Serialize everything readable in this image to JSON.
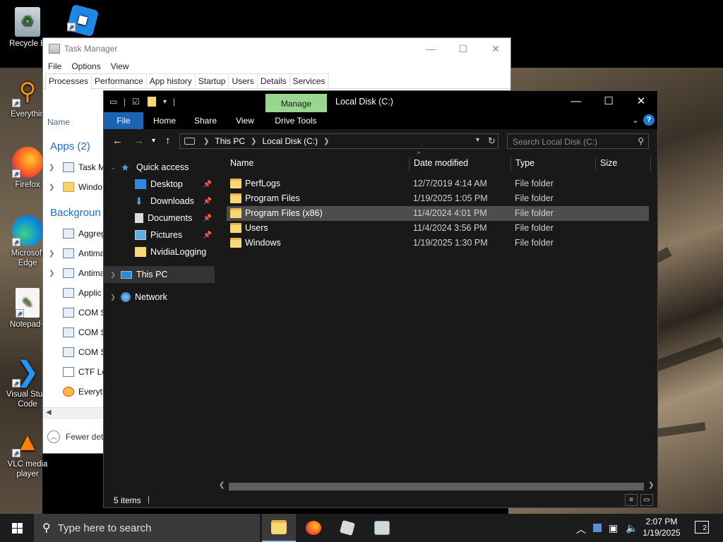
{
  "desktop": {
    "icons": [
      {
        "label": "Recycle Bin",
        "icon": "recycle-bin-icon"
      },
      {
        "label": "Roblox",
        "icon": "roblox-icon"
      },
      {
        "label": "Everything",
        "icon": "everything-search-icon"
      },
      {
        "label": "Firefox",
        "icon": "firefox-icon"
      },
      {
        "label": "Microsoft Edge",
        "icon": "edge-icon"
      },
      {
        "label": "Notepad++",
        "icon": "notepad-plus-plus-icon"
      },
      {
        "label": "Visual Studio Code",
        "icon": "vscode-icon"
      },
      {
        "label": "VLC media player",
        "icon": "vlc-icon"
      }
    ],
    "labels_visible": {
      "recycle": "Recycle B",
      "everything": "Everythin",
      "firefox": "Firefox",
      "edge_1": "Microsoft",
      "edge_2": "Edge",
      "notepad": "Notepad+",
      "vscode_1": "Visual Studi",
      "vscode_2": "Code",
      "vlc_1": "VLC media",
      "vlc_2": "player"
    }
  },
  "task_manager": {
    "title": "Task Manager",
    "menu": [
      "File",
      "Options",
      "View"
    ],
    "tabs": [
      "Processes",
      "Performance",
      "App history",
      "Startup",
      "Users",
      "Details",
      "Services"
    ],
    "active_tab": "Processes",
    "column_name": "Name",
    "apps_section": "Apps (2)",
    "background_section": "Backgroun",
    "apps": [
      "Task M",
      "Windo"
    ],
    "background": [
      "Aggreg",
      "Antima",
      "Antima",
      "Applic",
      "COM S",
      "COM S",
      "COM S",
      "CTF Lo",
      "Everyth"
    ],
    "footer": "Fewer det"
  },
  "explorer": {
    "title": "Local Disk (C:)",
    "contextual_tab": "Manage",
    "ribbon_tabs": [
      "File",
      "Home",
      "Share",
      "View",
      "Drive Tools"
    ],
    "breadcrumb": [
      "This PC",
      "Local Disk (C:)"
    ],
    "search_placeholder": "Search Local Disk (C:)",
    "nav": {
      "quick_access": "Quick access",
      "items": [
        {
          "label": "Desktop",
          "pinned": true
        },
        {
          "label": "Downloads",
          "pinned": true
        },
        {
          "label": "Documents",
          "pinned": true
        },
        {
          "label": "Pictures",
          "pinned": true
        },
        {
          "label": "NvidiaLogging",
          "pinned": false
        }
      ],
      "this_pc": "This PC",
      "network": "Network"
    },
    "columns": [
      "Name",
      "Date modified",
      "Type",
      "Size"
    ],
    "files": [
      {
        "name": "PerfLogs",
        "date": "12/7/2019 4:14 AM",
        "type": "File folder",
        "size": ""
      },
      {
        "name": "Program Files",
        "date": "1/19/2025 1:05 PM",
        "type": "File folder",
        "size": ""
      },
      {
        "name": "Program Files (x86)",
        "date": "11/4/2024 4:01 PM",
        "type": "File folder",
        "size": ""
      },
      {
        "name": "Users",
        "date": "11/4/2024 3:56 PM",
        "type": "File folder",
        "size": ""
      },
      {
        "name": "Windows",
        "date": "1/19/2025 1:30 PM",
        "type": "File folder",
        "size": ""
      }
    ],
    "selected_file": "Program Files (x86)",
    "status_count": "5 items"
  },
  "taskbar": {
    "search_placeholder": "Type here to search",
    "apps": [
      "file-explorer-icon",
      "firefox-icon",
      "roblox-icon",
      "task-manager-icon"
    ],
    "time": "2:07 PM",
    "date": "1/19/2025",
    "notifications": "2"
  }
}
